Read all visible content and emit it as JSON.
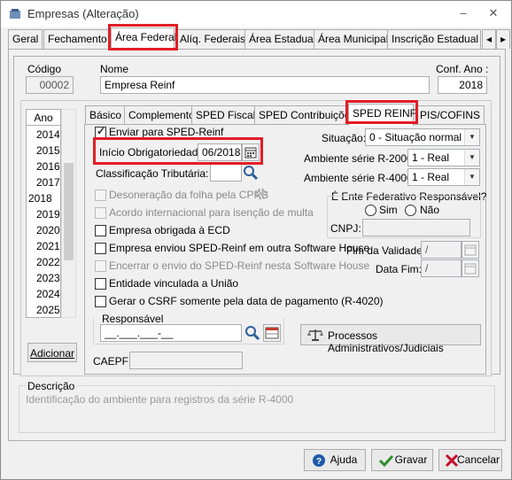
{
  "window": {
    "title": "Empresas (Alteração)",
    "minimize": "‒",
    "close": "✕"
  },
  "main_tabs": [
    "Geral",
    "Fechamento",
    "Área Federal",
    "Alíq. Federais",
    "Área Estadual",
    "Área Municipal",
    "Inscrição Estadual S"
  ],
  "main_tab_active": "Área Federal",
  "header": {
    "codigo_label": "Código",
    "codigo_value": "00002",
    "nome_label": "Nome",
    "nome_value": "Empresa Reinf",
    "conf_ano_label": "Conf. Ano :",
    "conf_ano_value": "2018"
  },
  "years": {
    "header": "Ano",
    "items": [
      "2014",
      "2015",
      "2016",
      "2017",
      "2018",
      "2019",
      "2020",
      "2021",
      "2022",
      "2023",
      "2024",
      "2025"
    ],
    "selected": "2018"
  },
  "adicionar_label": "Adicionar",
  "sub_tabs": [
    "Básico",
    "Complemento",
    "SPED Fiscal",
    "SPED Contribuições",
    "SPED REINF",
    "PIS/COFINS"
  ],
  "sub_tab_active": "SPED REINF",
  "reinf": {
    "enviar_label": "Enviar para SPED-Reinf",
    "inicio_label": "Início Obrigatoriedade:",
    "inicio_value": "06/2018",
    "classificacao_label": "Classificação Tributária:",
    "desoneracao_label": "Desoneração da folha pela CPRB",
    "acordo_label": "Acordo internacional para isenção de multa",
    "ecd_label": "Empresa obrigada à ECD",
    "enviou_label": "Empresa enviou SPED-Reinf em outra Software House",
    "encerrar_label": "Encerrar o envio do SPED-Reinf nesta Software House",
    "entidade_label": "Entidade vinculada a União",
    "csrf_label": "Gerar o CSRF somente pela data de pagamento (R-4020)",
    "situacao_label": "Situação:",
    "situacao_value": "0 - Situação normal",
    "amb2000_label": "Ambiente série R-2000:",
    "amb2000_value": "1 - Real",
    "amb4000_label": "Ambiente série R-4000:",
    "amb4000_value": "1 - Real",
    "ente_label": "É Ente Federativo Responsável?",
    "sim_label": "Sim",
    "nao_label": "Não",
    "cnpj_label": "CNPJ:",
    "fim_validade_label": "Fim da Validade:",
    "fim_validade_value": "  /",
    "data_fim_label": "Data Fim:",
    "data_fim_value": "  /",
    "responsavel_label": "Responsável",
    "responsavel_value": "__.___.___-__",
    "processos_label": "Processos Administrativos/Judiciais",
    "caepf_label": "CAEPF:"
  },
  "descricao": {
    "label": "Descrição",
    "text": "Identificação do ambiente para registros da série R-4000"
  },
  "footer": {
    "ajuda": "Ajuda",
    "gravar": "Gravar",
    "cancelar": "Cancelar"
  },
  "colors": {
    "highlight": "#e31d25",
    "accent_blue": "#1e5aa8",
    "ok_green": "#2e8b2e",
    "cancel_red": "#c8102e"
  }
}
